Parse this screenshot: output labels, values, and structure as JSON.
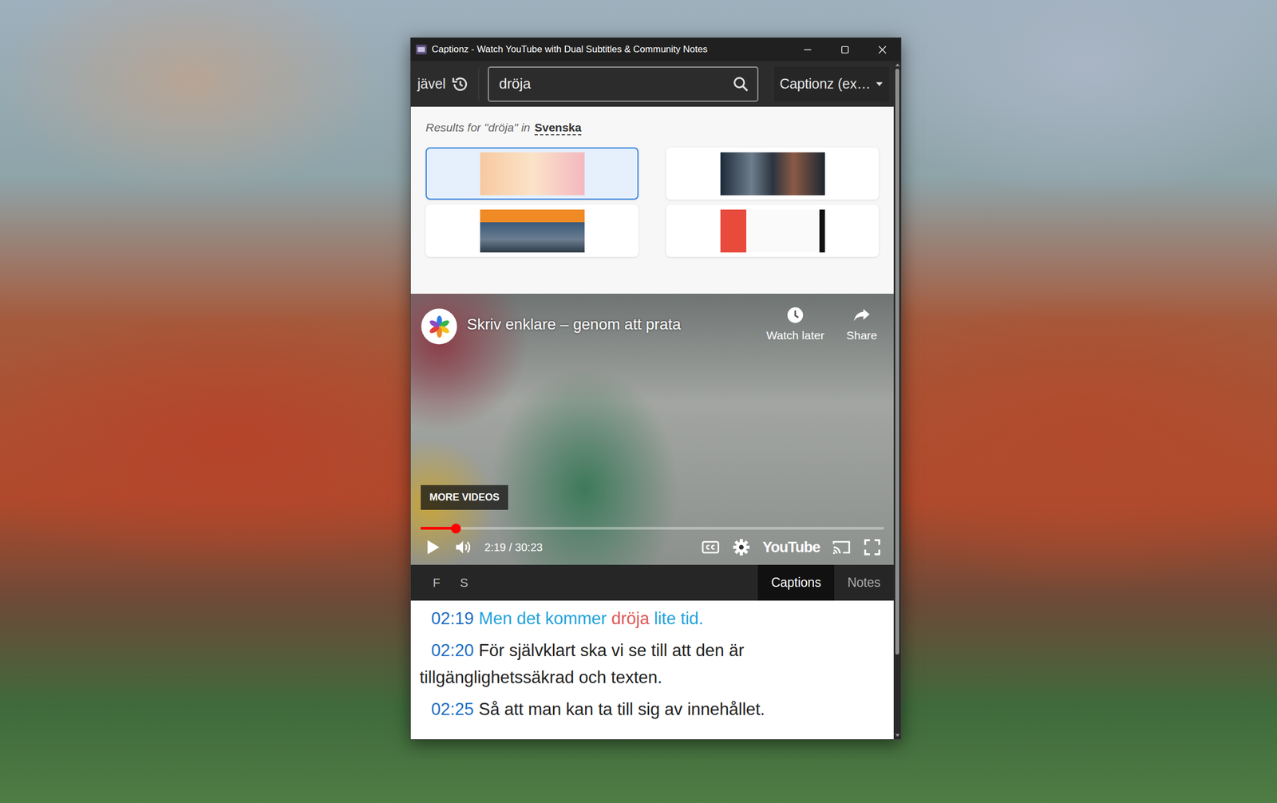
{
  "window": {
    "title": "Captionz - Watch YouTube with Dual Subtitles & Community Notes"
  },
  "toolbar": {
    "recent_word": "jävel",
    "search_value": "dröja",
    "source": "Captionz (ex…"
  },
  "results": {
    "prefix": "Results for \"dröja\" in",
    "language": "Svenska",
    "items": [
      {
        "selected": true
      },
      {
        "selected": false
      },
      {
        "selected": false
      },
      {
        "selected": false
      }
    ]
  },
  "video": {
    "title": "Skriv enklare – genom att prata",
    "watch_later": "Watch later",
    "share": "Share",
    "more_videos": "MORE VIDEOS",
    "time": "2:19 / 30:23",
    "level": 0.076,
    "brand": "YouTube",
    "playing": false
  },
  "panel_tabs": {
    "left": [
      "F",
      "S"
    ],
    "tabs": [
      {
        "label": "Captions",
        "selected": true
      },
      {
        "label": "Notes",
        "selected": false
      }
    ]
  },
  "captions": [
    {
      "time": "02:19",
      "active": true,
      "segments": [
        {
          "text": "Men det kommer ",
          "match": false
        },
        {
          "text": "dröja",
          "match": true
        },
        {
          "text": " lite tid.",
          "match": false
        }
      ]
    },
    {
      "time": "02:20",
      "active": false,
      "segments": [
        {
          "text": "För självklart ska vi se till att den är tillgänglighetssäkrad och texten.",
          "match": false
        }
      ]
    },
    {
      "time": "02:25",
      "active": false,
      "segments": [
        {
          "text": "Så att man kan ta till sig av innehållet.",
          "match": false
        }
      ]
    }
  ]
}
